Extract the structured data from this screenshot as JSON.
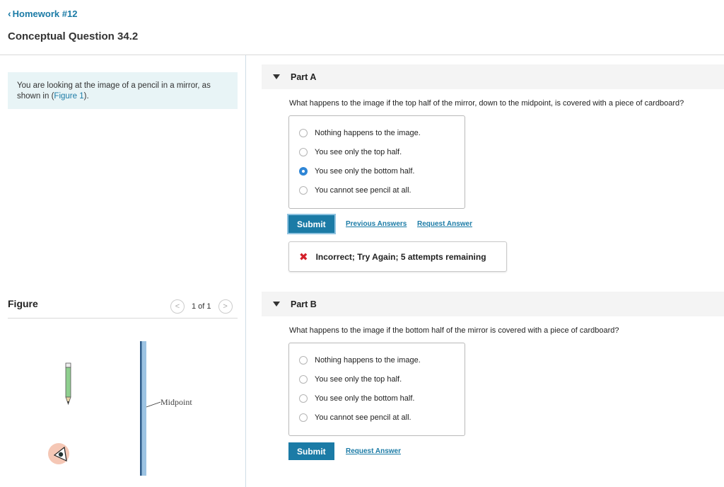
{
  "nav": {
    "back_label": "Homework #12"
  },
  "page": {
    "title": "Conceptual Question 34.2"
  },
  "intro": {
    "text": "You are looking at the image of a pencil in a mirror, as shown in (",
    "figure_link": "Figure 1",
    "text_end": ")."
  },
  "figure": {
    "heading": "Figure",
    "counter": "1 of 1",
    "midpoint_label": "Midpoint"
  },
  "part_a": {
    "title": "Part A",
    "question": "What happens to the image if the top half of the mirror, down to the midpoint, is covered with a piece of cardboard?",
    "choices": [
      {
        "label": "Nothing happens to the image.",
        "selected": false
      },
      {
        "label": "You see only the top half.",
        "selected": false
      },
      {
        "label": "You see only the bottom half.",
        "selected": true
      },
      {
        "label": "You cannot see pencil at all.",
        "selected": false
      }
    ],
    "submit_label": "Submit",
    "previous_answers_label": "Previous Answers",
    "request_answer_label": "Request Answer",
    "feedback": "Incorrect; Try Again; 5 attempts remaining"
  },
  "part_b": {
    "title": "Part B",
    "question": "What happens to the image if the bottom half of the mirror is covered with a piece of cardboard?",
    "choices": [
      {
        "label": "Nothing happens to the image.",
        "selected": false
      },
      {
        "label": "You see only the top half.",
        "selected": false
      },
      {
        "label": "You see only the bottom half.",
        "selected": false
      },
      {
        "label": "You cannot see pencil at all.",
        "selected": false
      }
    ],
    "submit_label": "Submit",
    "request_answer_label": "Request Answer"
  },
  "colors": {
    "accent": "#1b7ba6",
    "selected_radio": "#2f86d6",
    "error": "#d4202a",
    "intro_bg": "#e8f4f6"
  }
}
